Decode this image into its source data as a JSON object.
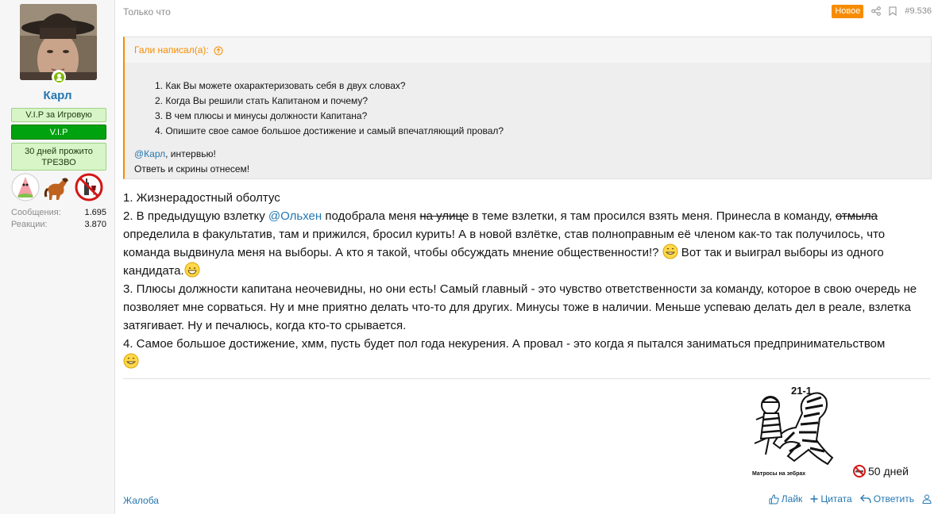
{
  "user": {
    "name": "Карл",
    "banners": [
      "V.I.P за Игровую",
      "V.I.P",
      "30 дней прожито ТРЕЗВО"
    ],
    "trophies": [
      "patrick-trophy-icon",
      "pony-trophy-icon",
      "no-alcohol-trophy-icon"
    ],
    "stats": [
      {
        "label": "Сообщения:",
        "value": "1.695"
      },
      {
        "label": "Реакции:",
        "value": "3.870"
      }
    ]
  },
  "post": {
    "time": "Только что",
    "badge": "Новое",
    "number": "#9.536"
  },
  "quote": {
    "author_line": "Гали написал(а):",
    "questions": [
      "1. Как Вы можете охарактеризовать себя в двух словах?",
      "2. Когда Вы решили стать Капитаном и почему?",
      "3. В чем плюсы и минусы должности Капитана?",
      "4. Опишите свое самое большое достижение и самый впечатляющий провал?"
    ],
    "mention": "@Карл",
    "line1_rest": ", интервью!",
    "line2": "Ответь и скрины отнесем!"
  },
  "body": {
    "p1": "1. Жизнерадостный оболтус",
    "p2_a": "2. В предыдущую взлетку ",
    "p2_mention": "@Ольхен",
    "p2_b": " подобрала меня ",
    "p2_strike1": "на улице",
    "p2_c": " в теме взлетки, я там просился взять меня. Принесла в команду, ",
    "p2_strike2": "отмыла",
    "p2_d": " определила в факультатив, там и прижился, бросил курить! А в новой взлётке, став полноправным её членом как-то так получилось, что команда выдвинула меня на выборы. А кто я такой, чтобы обсуждать мнение общественности!? ",
    "p2_e": " Вот так и выиграл выборы из одного кандидата.",
    "p3": "3. Плюсы должности капитана неочевидны, но они есть! Самый главный - это чувство ответственности за команду, которое в свою очередь не позволяет мне сорваться. Ну и мне приятно делать что-то для других. Минусы тоже в наличии. Меньше успеваю делать дел в реале, взлетка затягивает. Ну и печалюсь, когда кто-то срывается.",
    "p4": "4. Самое большое достижение, хмм, пусть будет пол года некурения. А провал - это когда я пытался заниматься предпринимательством"
  },
  "signature": {
    "number": "21-1",
    "caption": "Матросы на зебрах",
    "days": "50 дней"
  },
  "footer": {
    "report": "Жалоба",
    "like": "Лайк",
    "quote": "Цитата",
    "reply": "Ответить"
  },
  "colors": {
    "accent": "#f78c00",
    "link": "#2577b1",
    "banner_dark": "#00a20f",
    "banner_light": "#d7f5c7"
  }
}
